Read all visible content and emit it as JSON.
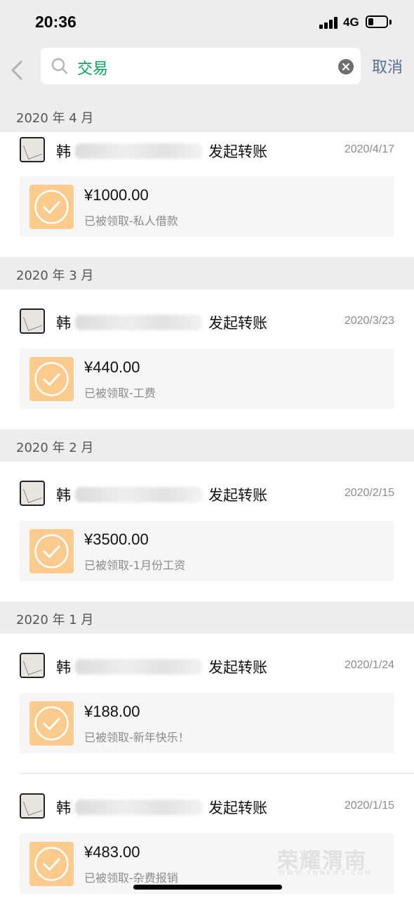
{
  "status_bar": {
    "time": "20:36",
    "network": "4G",
    "battery_level": 0.3
  },
  "search": {
    "query": "交易",
    "cancel_label": "取消"
  },
  "months": [
    "2020 年 4 月",
    "2020 年 3 月",
    "2020 年 2 月",
    "2020 年 1 月"
  ],
  "records": [
    {
      "sender_first": "韩",
      "action": "发起转账",
      "date": "2020/4/17",
      "amount": "¥1000.00",
      "status": "已被领取-私人借款"
    },
    {
      "sender_first": "韩",
      "action": "发起转账",
      "date": "2020/3/23",
      "amount": "¥440.00",
      "status": "已被领取-工费"
    },
    {
      "sender_first": "韩",
      "action": "发起转账",
      "date": "2020/2/15",
      "amount": "¥3500.00",
      "status": "已被领取-1月份工资"
    },
    {
      "sender_first": "韩",
      "action": "发起转账",
      "date": "2020/1/24",
      "amount": "¥188.00",
      "status": "已被领取-新年快乐！"
    },
    {
      "sender_first": "韩",
      "action": "发起转账",
      "date": "2020/1/15",
      "amount": "¥483.00",
      "status": "已被领取-杂费报销"
    }
  ],
  "watermark": {
    "text": "荣耀渭南",
    "sub": "WWW.YNNEWS.COM"
  },
  "colors": {
    "accent_green": "#07a35a",
    "link_blue": "#576b95",
    "transfer_icon": "#fbcb8e",
    "section_bg": "#ededed"
  }
}
